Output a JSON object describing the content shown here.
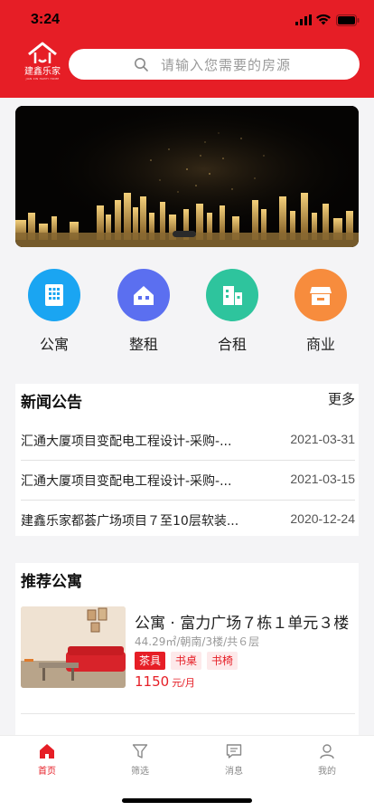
{
  "status_bar": {
    "time": "3:24"
  },
  "header": {
    "logo_text": "建鑫乐家",
    "logo_subtext": "JIAN XIN HAPPY HOME",
    "search_placeholder": "请输入您需要的房源",
    "bg_color": "#e61e26"
  },
  "categories": [
    {
      "label": "公寓",
      "icon": "apartment-building-icon",
      "color": "#1aa5f2"
    },
    {
      "label": "整租",
      "icon": "house-icon",
      "color": "#5b6ff0"
    },
    {
      "label": "合租",
      "icon": "office-building-icon",
      "color": "#2ec49d"
    },
    {
      "label": "商业",
      "icon": "storefront-icon",
      "color": "#f78c3d"
    }
  ],
  "news": {
    "title": "新闻公告",
    "more": "更多",
    "items": [
      {
        "text": "汇通大厦项目变配电工程设计-采购-...",
        "date": "2021-03-31"
      },
      {
        "text": "汇通大厦项目变配电工程设计-采购-...",
        "date": "2021-03-15"
      },
      {
        "text": "建鑫乐家都荟广场项目７至10层软装...",
        "date": "2020-12-24"
      }
    ]
  },
  "recommend": {
    "title": "推荐公寓",
    "listing": {
      "name": "公寓 · 富力广场７栋１单元３楼",
      "info": "44.29㎡/朝南/3楼/共６层",
      "tags": [
        "茶具",
        "书桌",
        "书椅"
      ],
      "price": "1150",
      "price_unit": "元/月"
    }
  },
  "tabbar": [
    {
      "label": "首页",
      "icon": "home-icon",
      "active": true
    },
    {
      "label": "筛选",
      "icon": "filter-icon",
      "active": false
    },
    {
      "label": "消息",
      "icon": "message-icon",
      "active": false
    },
    {
      "label": "我的",
      "icon": "profile-icon",
      "active": false
    }
  ]
}
